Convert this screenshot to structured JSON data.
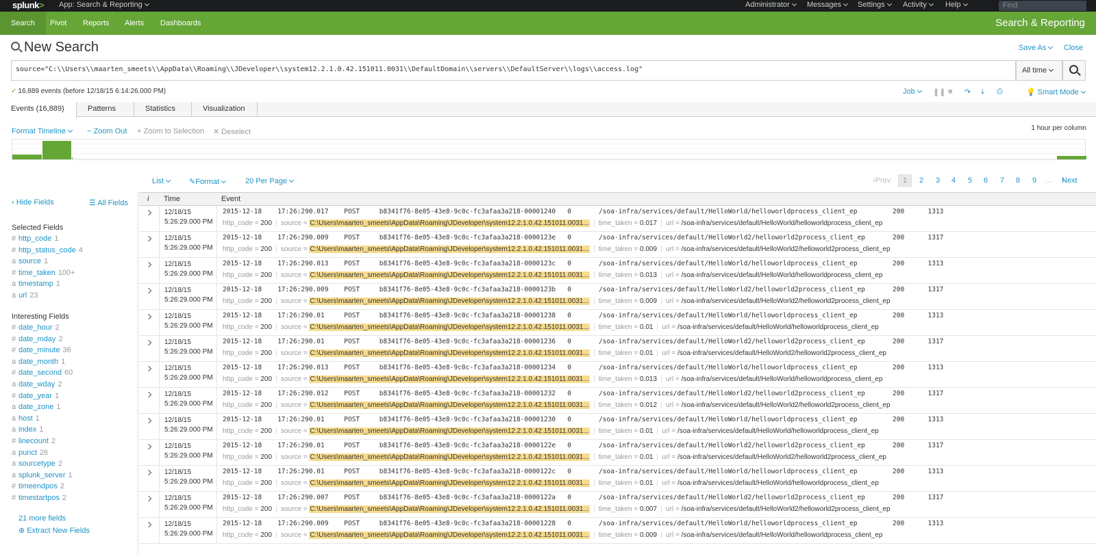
{
  "topbar": {
    "logo": "splunk",
    "logo_suffix": ">",
    "app": "App: Search & Reporting",
    "menus": [
      "Administrator",
      "Messages",
      "Settings",
      "Activity",
      "Help"
    ],
    "find_placeholder": "Find"
  },
  "nav": {
    "items": [
      "Search",
      "Pivot",
      "Reports",
      "Alerts",
      "Dashboards"
    ],
    "app_title": "Search & Reporting"
  },
  "search": {
    "heading": "New Search",
    "save_as": "Save As",
    "close": "Close",
    "query": "source=\"C:\\\\Users\\\\maarten_smeets\\\\AppData\\\\Roaming\\\\JDeveloper\\\\system12.2.1.0.42.151011.0031\\\\DefaultDomain\\\\servers\\\\DefaultServer\\\\logs\\\\access.log\"",
    "time_range": "All time",
    "status": "16,889 events (before 12/18/15 6:14:26.000 PM)",
    "job": "Job",
    "mode": "Smart Mode"
  },
  "tabs": [
    "Events (16,889)",
    "Patterns",
    "Statistics",
    "Visualization"
  ],
  "timeline": {
    "format": "Format Timeline",
    "zoom_out": "Zoom Out",
    "zoom_sel": "Zoom to Selection",
    "deselect": "Deselect",
    "scale": "1 hour per column",
    "bars": [
      0.25,
      1.0,
      0.1,
      0.18
    ]
  },
  "results_ctl": {
    "list": "List",
    "format": "Format",
    "per_page": "20 Per Page",
    "prev": "Prev",
    "pages": [
      "1",
      "2",
      "3",
      "4",
      "5",
      "6",
      "7",
      "8",
      "9"
    ],
    "ellipsis": "...",
    "next": "Next"
  },
  "sidebar": {
    "hide_fields": "Hide Fields",
    "all_fields": "All Fields",
    "selected_title": "Selected Fields",
    "selected": [
      {
        "type": "#",
        "name": "http_code",
        "count": "1"
      },
      {
        "type": "#",
        "name": "http_status_code",
        "count": "4"
      },
      {
        "type": "a",
        "name": "source",
        "count": "1"
      },
      {
        "type": "#",
        "name": "time_taken",
        "count": "100+"
      },
      {
        "type": "a",
        "name": "timestamp",
        "count": "1"
      },
      {
        "type": "a",
        "name": "url",
        "count": "23"
      }
    ],
    "interesting_title": "Interesting Fields",
    "interesting": [
      {
        "type": "#",
        "name": "date_hour",
        "count": "2"
      },
      {
        "type": "#",
        "name": "date_mday",
        "count": "2"
      },
      {
        "type": "#",
        "name": "date_minute",
        "count": "36"
      },
      {
        "type": "a",
        "name": "date_month",
        "count": "1"
      },
      {
        "type": "#",
        "name": "date_second",
        "count": "60"
      },
      {
        "type": "a",
        "name": "date_wday",
        "count": "2"
      },
      {
        "type": "#",
        "name": "date_year",
        "count": "1"
      },
      {
        "type": "a",
        "name": "date_zone",
        "count": "1"
      },
      {
        "type": "a",
        "name": "host",
        "count": "1"
      },
      {
        "type": "a",
        "name": "index",
        "count": "1"
      },
      {
        "type": "#",
        "name": "linecount",
        "count": "2"
      },
      {
        "type": "a",
        "name": "punct",
        "count": "26"
      },
      {
        "type": "a",
        "name": "sourcetype",
        "count": "2"
      },
      {
        "type": "a",
        "name": "splunk_server",
        "count": "1"
      },
      {
        "type": "#",
        "name": "timeendpos",
        "count": "2"
      },
      {
        "type": "#",
        "name": "timestartpos",
        "count": "2"
      }
    ],
    "more_fields": "21 more fields",
    "extract": "Extract New Fields"
  },
  "table": {
    "headers": [
      "i",
      "Time",
      "Event"
    ],
    "source_value": "C:\\Users\\maarten_smeets\\AppData\\Roaming\\JDeveloper\\system12.2.1.0.42.151011.0031...",
    "rows": [
      {
        "date": "12/18/15",
        "time": "5:26:29.000 PM",
        "raw": "2015-12-18    17:26:290.017    POST     b8341f76-8e05-43e8-9c0c-fc3afaa3a218-00001240   0       /soa-infra/services/default/HelloWorld/helloworldprocess_client_ep         200      1313",
        "http_code": "200",
        "time_taken": "0.017",
        "url": "/soa-infra/services/default/HelloWorld/helloworldprocess_client_ep"
      },
      {
        "date": "12/18/15",
        "time": "5:26:29.000 PM",
        "raw": "2015-12-18    17:26:290.009    POST     b8341f76-8e05-43e8-9c0c-fc3afaa3a218-0000123e   0       /soa-infra/services/default/HelloWorld2/helloworld2process_client_ep       200      1317",
        "http_code": "200",
        "time_taken": "0.009",
        "url": "/soa-infra/services/default/HelloWorld2/helloworld2process_client_ep"
      },
      {
        "date": "12/18/15",
        "time": "5:26:29.000 PM",
        "raw": "2015-12-18    17:26:290.013    POST     b8341f76-8e05-43e8-9c0c-fc3afaa3a218-0000123c   0       /soa-infra/services/default/HelloWorld/helloworldprocess_client_ep         200      1313",
        "http_code": "200",
        "time_taken": "0.013",
        "url": "/soa-infra/services/default/HelloWorld/helloworldprocess_client_ep"
      },
      {
        "date": "12/18/15",
        "time": "5:26:29.000 PM",
        "raw": "2015-12-18    17:26:290.009    POST     b8341f76-8e05-43e8-9c0c-fc3afaa3a218-0000123b   0       /soa-infra/services/default/HelloWorld2/helloworld2process_client_ep       200      1317",
        "http_code": "200",
        "time_taken": "0.009",
        "url": "/soa-infra/services/default/HelloWorld2/helloworld2process_client_ep"
      },
      {
        "date": "12/18/15",
        "time": "5:26:29.000 PM",
        "raw": "2015-12-18    17:26:290.01     POST     b8341f76-8e05-43e8-9c0c-fc3afaa3a218-00001238   0       /soa-infra/services/default/HelloWorld/helloworldprocess_client_ep         200      1313",
        "http_code": "200",
        "time_taken": "0.01",
        "url": "/soa-infra/services/default/HelloWorld/helloworldprocess_client_ep"
      },
      {
        "date": "12/18/15",
        "time": "5:26:29.000 PM",
        "raw": "2015-12-18    17:26:290.01     POST     b8341f76-8e05-43e8-9c0c-fc3afaa3a218-00001236   0       /soa-infra/services/default/HelloWorld2/helloworld2process_client_ep       200      1317",
        "http_code": "200",
        "time_taken": "0.01",
        "url": "/soa-infra/services/default/HelloWorld2/helloworld2process_client_ep"
      },
      {
        "date": "12/18/15",
        "time": "5:26:29.000 PM",
        "raw": "2015-12-18    17:26:290.013    POST     b8341f76-8e05-43e8-9c0c-fc3afaa3a218-00001234   0       /soa-infra/services/default/HelloWorld/helloworldprocess_client_ep         200      1313",
        "http_code": "200",
        "time_taken": "0.013",
        "url": "/soa-infra/services/default/HelloWorld/helloworldprocess_client_ep"
      },
      {
        "date": "12/18/15",
        "time": "5:26:29.000 PM",
        "raw": "2015-12-18    17:26:290.012    POST     b8341f76-8e05-43e8-9c0c-fc3afaa3a218-00001232   0       /soa-infra/services/default/HelloWorld2/helloworld2process_client_ep       200      1317",
        "http_code": "200",
        "time_taken": "0.012",
        "url": "/soa-infra/services/default/HelloWorld2/helloworld2process_client_ep"
      },
      {
        "date": "12/18/15",
        "time": "5:26:29.000 PM",
        "raw": "2015-12-18    17:26:290.01     POST     b8341f76-8e05-43e8-9c0c-fc3afaa3a218-00001230   0       /soa-infra/services/default/HelloWorld/helloworldprocess_client_ep         200      1313",
        "http_code": "200",
        "time_taken": "0.01",
        "url": "/soa-infra/services/default/HelloWorld/helloworldprocess_client_ep"
      },
      {
        "date": "12/18/15",
        "time": "5:26:29.000 PM",
        "raw": "2015-12-18    17:26:290.01     POST     b8341f76-8e05-43e8-9c0c-fc3afaa3a218-0000122e   0       /soa-infra/services/default/HelloWorld2/helloworld2process_client_ep       200      1317",
        "http_code": "200",
        "time_taken": "0.01",
        "url": "/soa-infra/services/default/HelloWorld2/helloworld2process_client_ep"
      },
      {
        "date": "12/18/15",
        "time": "5:26:29.000 PM",
        "raw": "2015-12-18    17:26:290.01     POST     b8341f76-8e05-43e8-9c0c-fc3afaa3a218-0000122c   0       /soa-infra/services/default/HelloWorld/helloworldprocess_client_ep         200      1313",
        "http_code": "200",
        "time_taken": "0.01",
        "url": "/soa-infra/services/default/HelloWorld/helloworldprocess_client_ep"
      },
      {
        "date": "12/18/15",
        "time": "5:26:29.000 PM",
        "raw": "2015-12-18    17:26:290.007    POST     b8341f76-8e05-43e8-9c0c-fc3afaa3a218-0000122a   0       /soa-infra/services/default/HelloWorld2/helloworld2process_client_ep       200      1317",
        "http_code": "200",
        "time_taken": "0.007",
        "url": "/soa-infra/services/default/HelloWorld2/helloworld2process_client_ep"
      },
      {
        "date": "12/18/15",
        "time": "5:26:29.000 PM",
        "raw": "2015-12-18    17:26:290.009    POST     b8341f76-8e05-43e8-9c0c-fc3afaa3a218-00001228   0       /soa-infra/services/default/HelloWorld/helloworldprocess_client_ep         200      1313",
        "http_code": "200",
        "time_taken": "0.009",
        "url": "/soa-infra/services/default/HelloWorld/helloworldprocess_client_ep"
      }
    ]
  },
  "colors": {
    "brand": "#65a637",
    "topbar": "#1a1c1d",
    "link": "#1e93c6",
    "highlight": "#f7dc8f"
  }
}
